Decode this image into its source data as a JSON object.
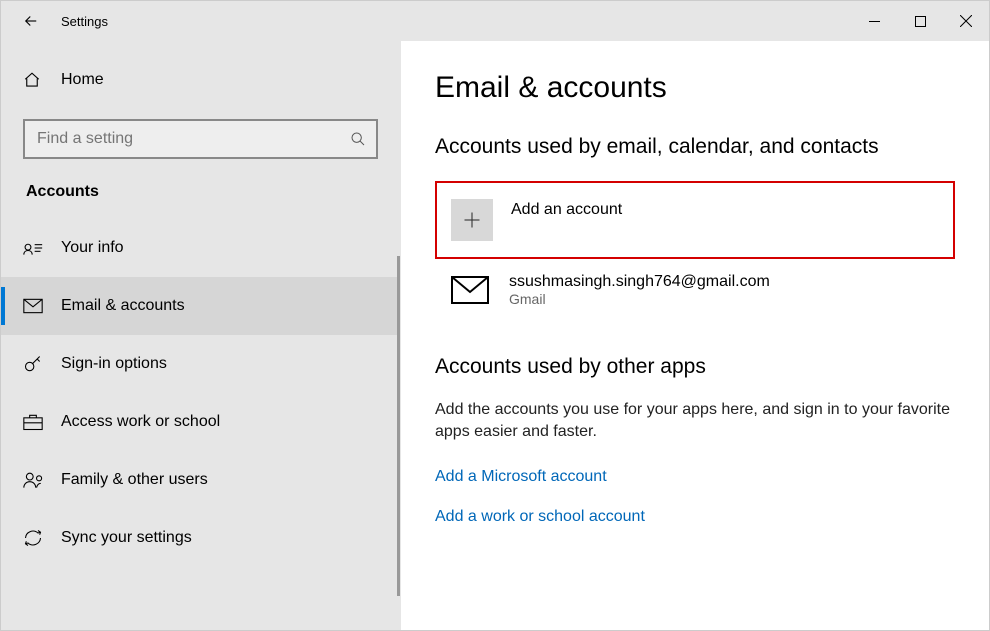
{
  "window": {
    "title": "Settings"
  },
  "sidebar": {
    "home_label": "Home",
    "search_placeholder": "Find a setting",
    "category": "Accounts",
    "items": [
      {
        "label": "Your info"
      },
      {
        "label": "Email & accounts"
      },
      {
        "label": "Sign-in options"
      },
      {
        "label": "Access work or school"
      },
      {
        "label": "Family & other users"
      },
      {
        "label": "Sync your settings"
      }
    ]
  },
  "main": {
    "page_title": "Email & accounts",
    "section1_title": "Accounts used by email, calendar, and contacts",
    "add_account": "Add an account",
    "accounts": [
      {
        "email": "ssushmasingh.singh764@gmail.com",
        "provider": "Gmail"
      }
    ],
    "section2_title": "Accounts used by other apps",
    "section2_desc": "Add the accounts you use for your apps here, and sign in to your favorite apps easier and faster.",
    "link_ms": "Add a Microsoft account",
    "link_ws": "Add a work or school account"
  }
}
